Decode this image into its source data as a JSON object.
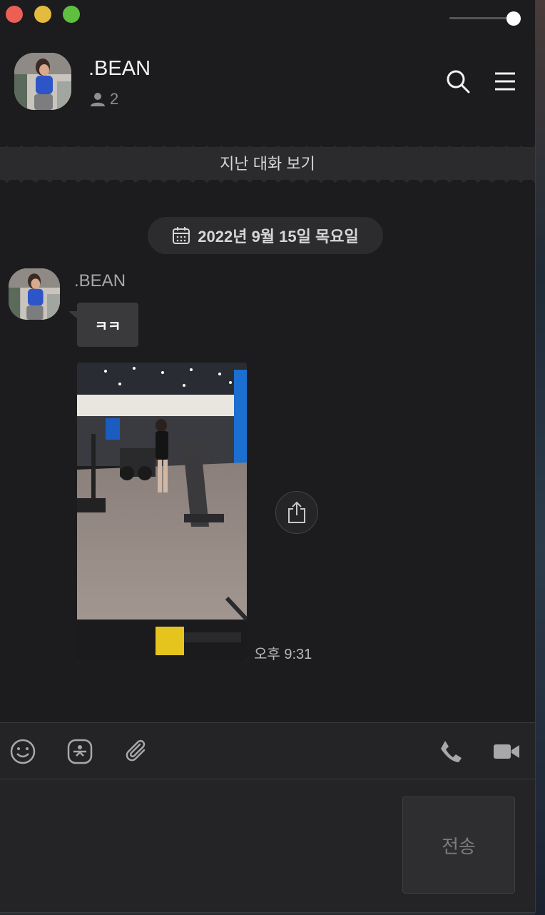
{
  "window": {
    "traffic_lights": {
      "close": "#ec5f57",
      "minimize": "#e3bb3e",
      "maximize": "#5fc03f"
    }
  },
  "header": {
    "room_name": ".BEAN",
    "member_count": "2",
    "icons": [
      "person-icon",
      "search-icon",
      "menu-icon"
    ]
  },
  "history": {
    "label": "지난 대화 보기"
  },
  "date_divider": {
    "label": "2022년 9월 15일 목요일",
    "icon": "calendar-icon"
  },
  "message": {
    "sender": ".BEAN",
    "text": "ㅋㅋ",
    "time": "오후 9:31",
    "attachment": "photo",
    "share_icon": "share-icon"
  },
  "toolbar": {
    "left_icons": [
      "emoji-icon",
      "emoticon-icon",
      "attach-icon"
    ],
    "right_icons": [
      "phone-icon",
      "video-icon"
    ]
  },
  "composer": {
    "send_label": "전송",
    "placeholder": ""
  },
  "colors": {
    "background": "#1c1c1e",
    "bubble": "#3a3a3c",
    "panel": "#242426"
  }
}
